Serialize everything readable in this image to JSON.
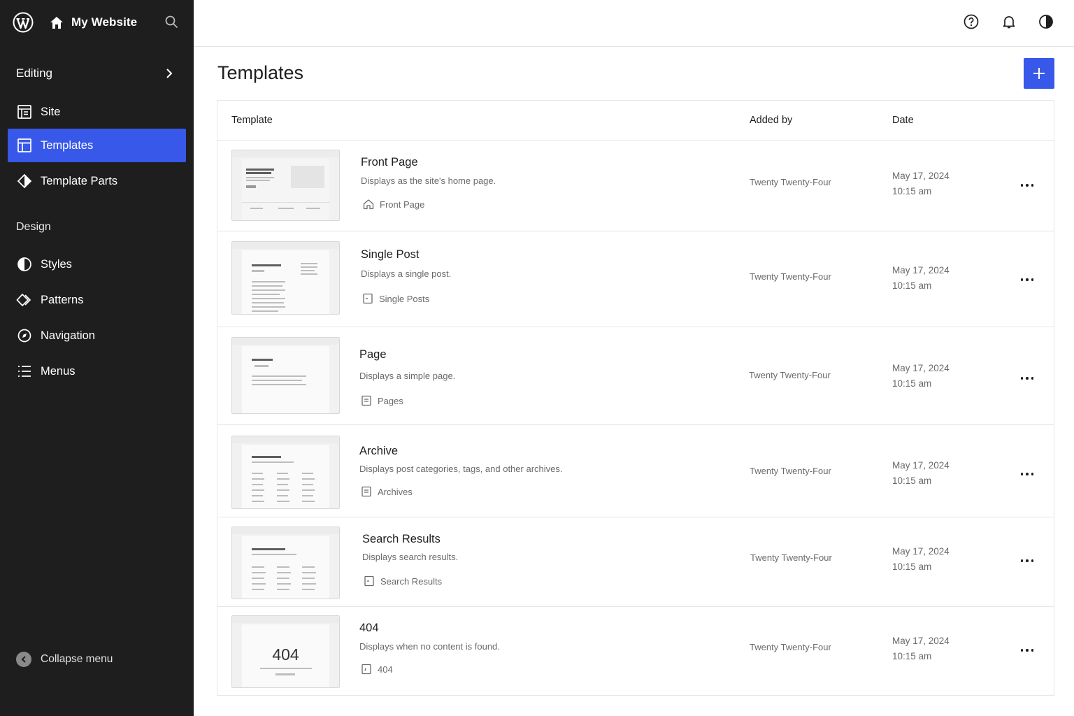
{
  "site": {
    "name": "My Website"
  },
  "sidebar": {
    "section_editing": "Editing",
    "items_editing": [
      {
        "label": "Site",
        "icon": "site-icon"
      },
      {
        "label": "Templates",
        "icon": "templates-icon",
        "active": true
      },
      {
        "label": "Template Parts",
        "icon": "template-parts-icon"
      }
    ],
    "section_design": "Design",
    "items_design": [
      {
        "label": "Styles",
        "icon": "styles-icon"
      },
      {
        "label": "Patterns",
        "icon": "patterns-icon"
      },
      {
        "label": "Navigation",
        "icon": "navigation-icon"
      },
      {
        "label": "Menus",
        "icon": "menus-icon"
      }
    ],
    "collapse_label": "Collapse menu"
  },
  "topbar": {
    "icons": [
      "help-icon",
      "bell-icon",
      "contrast-icon"
    ]
  },
  "main": {
    "title": "Templates",
    "add_button_icon": "plus-icon",
    "columns": {
      "template": "Template",
      "added_by": "Added by",
      "date": "Date"
    },
    "rows": [
      {
        "title": "Front Page",
        "description": "Displays as the site's home page.",
        "meta": "Front Page",
        "meta_icon": "home-icon",
        "author": "Twenty Twenty-Four",
        "date": "May 17, 2024",
        "time": "10:15 am"
      },
      {
        "title": "Single Post",
        "description": "Displays a single post.",
        "meta": "Single Posts",
        "meta_icon": "post-icon",
        "author": "Twenty Twenty-Four",
        "date": "May 17, 2024",
        "time": "10:15 am"
      },
      {
        "title": "Page",
        "description": "Displays a simple page.",
        "meta": "Pages",
        "meta_icon": "page-icon",
        "author": "Twenty Twenty-Four",
        "date": "May 17, 2024",
        "time": "10:15 am"
      },
      {
        "title": "Archive",
        "description": "Displays post categories, tags, and other archives.",
        "meta": "Archives",
        "meta_icon": "archive-icon",
        "author": "Twenty Twenty-Four",
        "date": "May 17, 2024",
        "time": "10:15 am"
      },
      {
        "title": "Search Results",
        "description": "Displays search results.",
        "meta": "Search Results",
        "meta_icon": "search-results-icon",
        "author": "Twenty Twenty-Four",
        "date": "May 17, 2024",
        "time": "10:15 am"
      },
      {
        "title": "404",
        "description": "Displays when no content is found.",
        "meta": "404",
        "meta_icon": "404-icon",
        "author": "Twenty Twenty-Four",
        "date": "May 17, 2024",
        "time": "10:15 am",
        "thumb_text": "404"
      }
    ]
  },
  "colors": {
    "sidebar_bg": "#1e1e1e",
    "accent": "#3858e9"
  }
}
